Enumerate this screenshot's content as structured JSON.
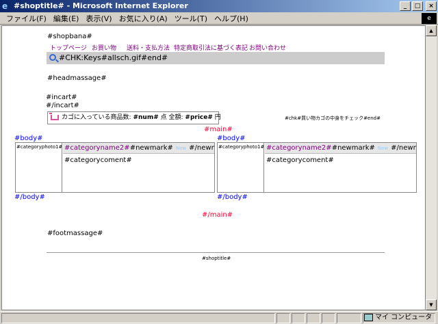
{
  "window": {
    "title": "#shoptitle# - Microsoft Internet Explorer",
    "buttons": {
      "minimize": "_",
      "maximize": "□",
      "close": "×"
    }
  },
  "menubar": [
    "ファイル(F)",
    "編集(E)",
    "表示(V)",
    "お気に入り(A)",
    "ツール(T)",
    "ヘルプ(H)"
  ],
  "page": {
    "shopbana": "#shopbana#",
    "nav": [
      "トップページ",
      "お買い物",
      "送料・支払方法",
      "特定商取引法に基づく表記",
      "お問い合わせ"
    ],
    "search": "#CHK:Keys#allsch.gif#end#",
    "headmassage": "#headmassage#",
    "incart_open": "#incart#",
    "incart_close": "#/incart#",
    "cart": {
      "prefix": "カゴに入っている商品数:",
      "num": "#num#",
      "unit": "点 全額:",
      "price": "#price#",
      "currency": "円"
    },
    "chk_text": "#chk#買い物カゴの中身をチェック#end#",
    "main_open": "#main#",
    "main_close": "#/main#",
    "products": [
      {
        "body_open": "#body#",
        "photo": "#categoryphoto1#",
        "name": "#categoryname2#",
        "newmark": "#newmark#",
        "new_label": "New",
        "newmark_close": "#/newmark#",
        "coment": "#categorycoment#",
        "body_close": "#/body#"
      },
      {
        "body_open": "#body#",
        "photo": "#categoryphoto1#",
        "name": "#categoryname2#",
        "newmark": "#newmark#",
        "new_label": "New",
        "newmark_close": "#/newmark#",
        "coment": "#categorycoment#",
        "body_close": "#/body#"
      }
    ],
    "footmassage": "#footmassage#",
    "footer_title": "#shoptitle#"
  },
  "statusbar": {
    "zone": "マイ コンピュータ"
  }
}
